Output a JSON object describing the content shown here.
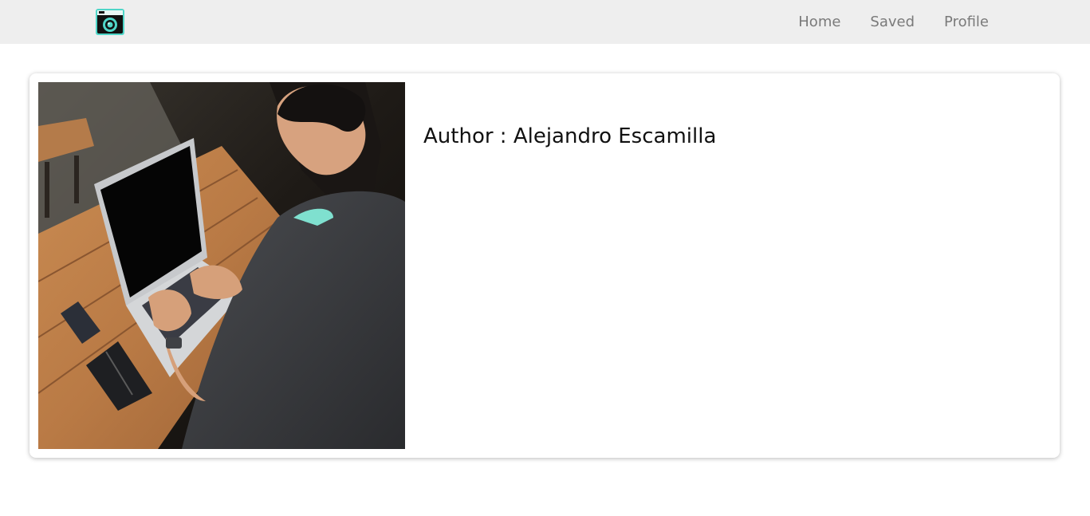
{
  "navbar": {
    "logo_icon": "camera-icon",
    "links": [
      "Home",
      "Saved",
      "Profile"
    ]
  },
  "card": {
    "image_subject": "person-typing-on-laptop-photo",
    "author_text": "Author : Alejandro Escamilla"
  },
  "colors": {
    "navbar_bg": "#eeeeee",
    "nav_text": "#7a7a7a",
    "logo_accent": "#4fd6c8",
    "logo_dark": "#111111"
  }
}
